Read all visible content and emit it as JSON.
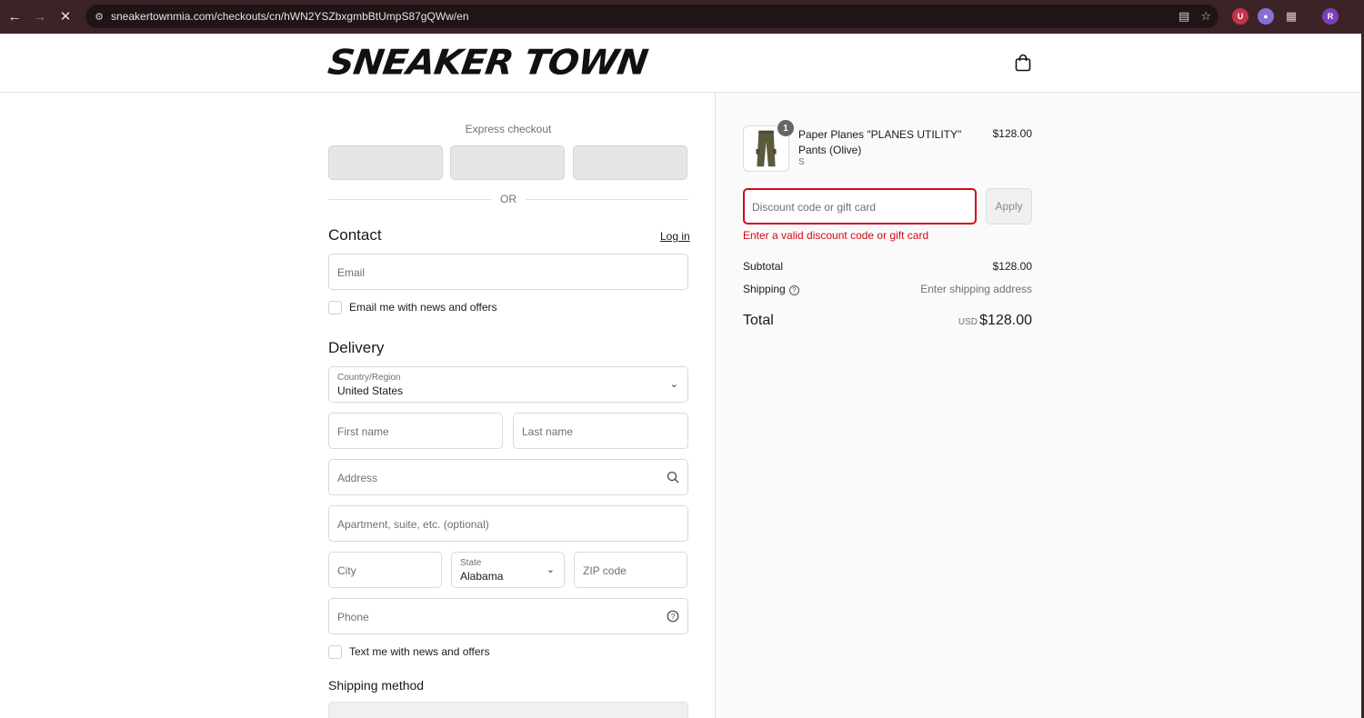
{
  "browser": {
    "url": "sneakertownmia.com/checkouts/cn/hWN2YSZbxgmbBtUmpS87gQWw/en",
    "profile_initial": "R"
  },
  "header": {
    "logo_text": "SNEAKER TOWN"
  },
  "express": {
    "label": "Express checkout",
    "divider_text": "OR"
  },
  "contact": {
    "title": "Contact",
    "login_label": "Log in",
    "email_placeholder": "Email",
    "newsletter_label": "Email me with news and offers"
  },
  "delivery": {
    "title": "Delivery",
    "country_label": "Country/Region",
    "country_value": "United States",
    "first_name_placeholder": "First name",
    "last_name_placeholder": "Last name",
    "address_placeholder": "Address",
    "apartment_placeholder": "Apartment, suite, etc. (optional)",
    "city_placeholder": "City",
    "state_label": "State",
    "state_value": "Alabama",
    "zip_placeholder": "ZIP code",
    "phone_placeholder": "Phone",
    "sms_label": "Text me with news and offers"
  },
  "shipping_method": {
    "title": "Shipping method"
  },
  "order": {
    "item": {
      "quantity": "1",
      "name": "Paper Planes \"PLANES UTILITY\" Pants (Olive)",
      "variant": "S",
      "price": "$128.00"
    },
    "discount_placeholder": "Discount code or gift card",
    "apply_label": "Apply",
    "discount_error": "Enter a valid discount code or gift card",
    "subtotal_label": "Subtotal",
    "subtotal_value": "$128.00",
    "shipping_label": "Shipping",
    "shipping_value": "Enter shipping address",
    "total_label": "Total",
    "total_currency": "USD",
    "total_value": "$128.00"
  },
  "colors": {
    "error": "#d10a16",
    "chrome_bg": "#3b2328"
  }
}
